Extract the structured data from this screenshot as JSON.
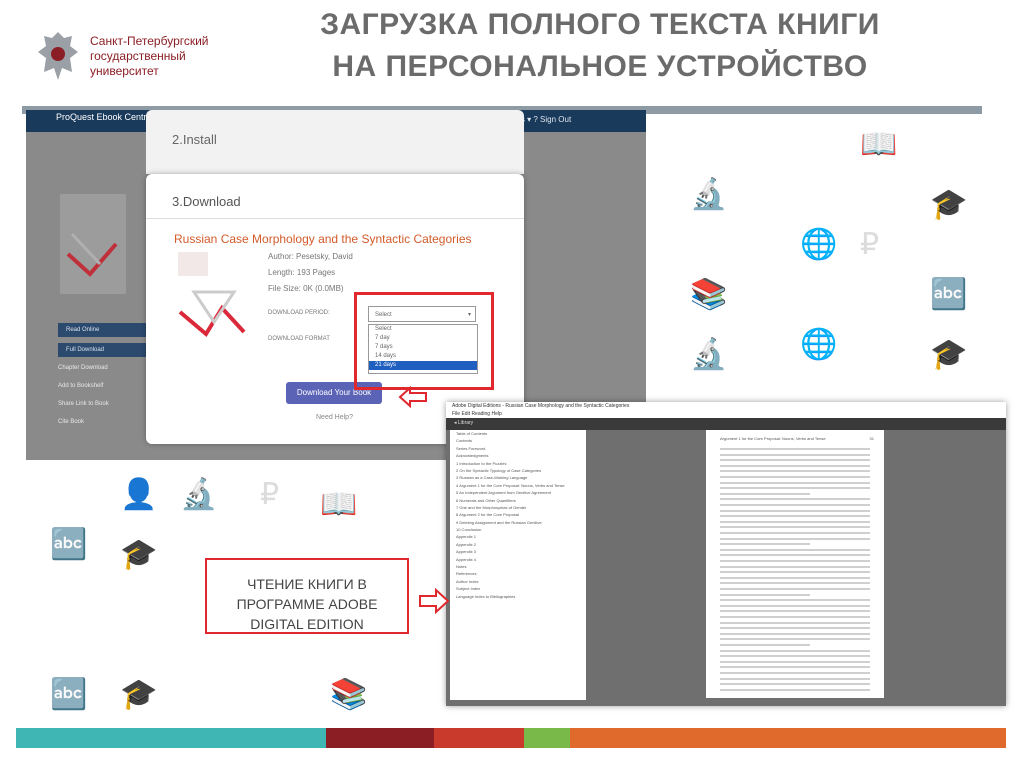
{
  "header": {
    "logo_line1": "Санкт-Петербургский",
    "logo_line2": "государственный",
    "logo_line3": "университет",
    "title_line1": "ЗАГРУЗКА ПОЛНОГО ТЕКСТА КНИГИ",
    "title_line2": "НА ПЕРСОНАЛЬНОЕ УСТРОЙСТВО"
  },
  "ebook_central": {
    "brand": "ProQuest Ebook Central",
    "menu": "Settings ▾   ?   Sign Out",
    "sidebar": [
      "Read Online",
      "Full Download"
    ],
    "links": [
      "Chapter Download",
      "Add to Bookshelf",
      "Share Link to Book",
      "Cite Book"
    ]
  },
  "dialog": {
    "step2": "2.Install",
    "step3": "3.Download",
    "book_title": "Russian Case Morphology and the Syntactic Categories",
    "author": "Author: Pesetsky, David",
    "length": "Length: 193 Pages",
    "file_size": "File Size: 0K (0.0MB)",
    "period_label": "DOWNLOAD PERIOD:",
    "format_label": "DOWNLOAD FORMAT",
    "select_placeholder": "Select",
    "options": [
      "Select",
      "7 day",
      "7 days",
      "14 days",
      "21 days"
    ],
    "download_button": "Download Your Book",
    "need_help": "Need Help?"
  },
  "adobe": {
    "window_title": "Adobe Digital Editions - Russian Case Morphology and the Syntactic Categories",
    "menu": "File   Edit   Reading   Help",
    "library": "◂ Library",
    "toc": [
      "Table of Contents",
      "Contents",
      "Series Foreword",
      "Acknowledgments",
      "1 Introduction to the Puzzles",
      "2 On the Syntactic Typology of Case Categories",
      "3 Russian as a Case-Marking Language",
      "4 Argument 1 for the Core Proposal: Nouns, Verbs and Tense",
      "5 An Independent Argument from Genitive Agreement",
      "6 Numerals and Other Quantifiers",
      "7 One and the Morphosyntax of Gender",
      "8 Argument 2 for the Core Proposal",
      "9 Deleting Assignment and the Russian Genitive",
      "10 Conclusion",
      "Appendix 1",
      "Appendix 2",
      "Appendix 3",
      "Appendix 4",
      "Notes",
      "References",
      "Author Index",
      "Subject Index",
      "Language Index to Bibliographies"
    ],
    "page_header": "Argument 1 for the Core Proposal: Nouns, Verbs and Tense",
    "page_number": "31"
  },
  "caption": {
    "line1": "ЧТЕНИЕ КНИГИ В",
    "line2": "ПРОГРАММЕ ADOBE",
    "line3": "DIGITAL EDITION"
  },
  "colors": {
    "accent_red": "#e0282d",
    "title_gray": "#6b6b6b",
    "navy": "#1a3a5c",
    "footer": [
      "#3fb6b3",
      "#8b1e24",
      "#c9392c",
      "#78b94a",
      "#e06a2c"
    ]
  }
}
